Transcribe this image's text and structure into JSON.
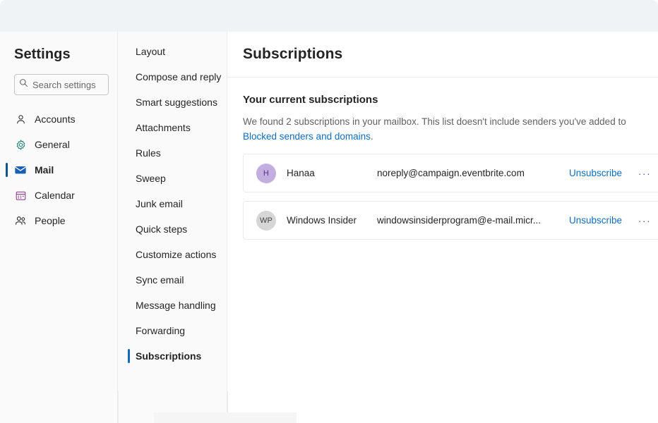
{
  "window": {
    "title": "Settings"
  },
  "sidebar": {
    "title": "Settings",
    "search": {
      "placeholder": "Search settings",
      "value": ""
    },
    "items": [
      {
        "label": "Accounts",
        "icon": "person-icon",
        "selected": false
      },
      {
        "label": "General",
        "icon": "gear-icon",
        "selected": false
      },
      {
        "label": "Mail",
        "icon": "mail-icon",
        "selected": true
      },
      {
        "label": "Calendar",
        "icon": "calendar-icon",
        "selected": false
      },
      {
        "label": "People",
        "icon": "people-icon",
        "selected": false
      }
    ]
  },
  "subnav": {
    "items": [
      {
        "label": "Layout",
        "selected": false
      },
      {
        "label": "Compose and reply",
        "selected": false
      },
      {
        "label": "Smart suggestions",
        "selected": false
      },
      {
        "label": "Attachments",
        "selected": false
      },
      {
        "label": "Rules",
        "selected": false
      },
      {
        "label": "Sweep",
        "selected": false
      },
      {
        "label": "Junk email",
        "selected": false
      },
      {
        "label": "Quick steps",
        "selected": false
      },
      {
        "label": "Customize actions",
        "selected": false
      },
      {
        "label": "Sync email",
        "selected": false
      },
      {
        "label": "Message handling",
        "selected": false
      },
      {
        "label": "Forwarding",
        "selected": false
      },
      {
        "label": "Subscriptions",
        "selected": true
      }
    ]
  },
  "main": {
    "title": "Subscriptions",
    "section_title": "Your current subscriptions",
    "description_before": "We found 2 subscriptions in your mailbox. This list doesn't include senders you've added to ",
    "description_link": "Blocked senders and domains",
    "description_after": ".",
    "subscriptions": [
      {
        "initials": "H",
        "name": "Hanaa",
        "email": "noreply@campaign.eventbrite.com",
        "action_label": "Unsubscribe",
        "more_label": "···",
        "avatar_bg": "#c3aee0",
        "avatar_fg": "#5c2e91"
      },
      {
        "initials": "WP",
        "name": "Windows Insider",
        "email": "windowsinsiderprogram@e-mail.micr...",
        "action_label": "Unsubscribe",
        "more_label": "···",
        "avatar_bg": "#d6d6d6",
        "avatar_fg": "#424242"
      }
    ]
  },
  "colors": {
    "accent": "#0f6cbd",
    "selected_bar": "#0f548c",
    "topbar_bg": "#eff3f6",
    "sidebar_bg": "#fafafa",
    "text": "#242424",
    "muted_text": "#616161",
    "divider": "#ebebeb",
    "mail_icon": "#1a5fb4",
    "gear_icon": "#1d7a6b",
    "calendar_icon": "#8b2f8b"
  }
}
